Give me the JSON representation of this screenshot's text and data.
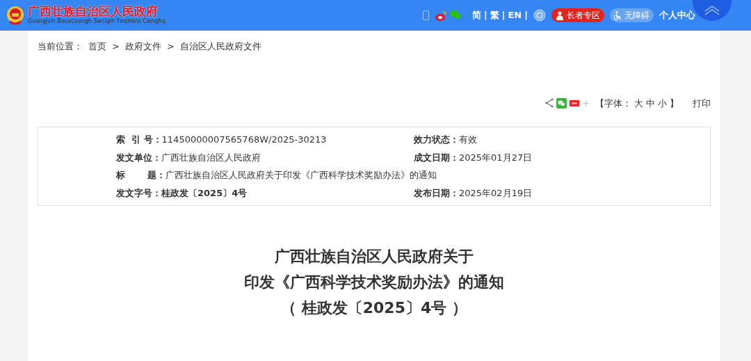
{
  "header": {
    "site_name": "广西壮族自治区人民政府",
    "site_subtitle": "Gvangjsih Bouxcuengh Swcigih Yinzminz Cwngfuj",
    "languages": [
      "简",
      "繁",
      "EN"
    ],
    "separator": "|",
    "elderly": "长者专区",
    "accessibility": "无障碍",
    "personal": "个人中心"
  },
  "breadcrumb": {
    "label": "当前位置：",
    "items": [
      "首页",
      "政府文件",
      "自治区人民政府文件"
    ],
    "separator": ">"
  },
  "tools": {
    "plus": "+",
    "font_label_open": "【字体：",
    "font_sizes": [
      {
        "label": "大"
      },
      {
        "label": "中"
      },
      {
        "label": "小"
      }
    ],
    "font_label_close": "】",
    "print": "打印"
  },
  "meta_rows": [
    {
      "fields": [
        {
          "label": "索  引 号：",
          "value": "11450000007565768W/2025-30213",
          "bold": false
        },
        {
          "label": "效力状态：",
          "value": "有效",
          "bold": false
        }
      ]
    },
    {
      "fields": [
        {
          "label": "发文单位：",
          "value": "广西壮族自治区人民政府",
          "bold": false
        },
        {
          "label": "成文日期：",
          "value": "2025年01月27日",
          "bold": false
        }
      ]
    },
    {
      "fields": [
        {
          "label": "标       题：",
          "value": "广西壮族自治区人民政府关于印发《广西科学技术奖励办法》的通知",
          "bold": false
        }
      ]
    },
    {
      "fields": [
        {
          "label": "发文字号：",
          "value": "桂政发〔2025〕4号",
          "bold": true
        },
        {
          "label": "发布日期：",
          "value": "2025年02月19日",
          "bold": false
        }
      ]
    }
  ],
  "title_lines": [
    "广西壮族自治区人民政府关于",
    "印发《广西科学技术奖励办法》的通知",
    "（ 桂政发〔2025〕4号 ）"
  ]
}
